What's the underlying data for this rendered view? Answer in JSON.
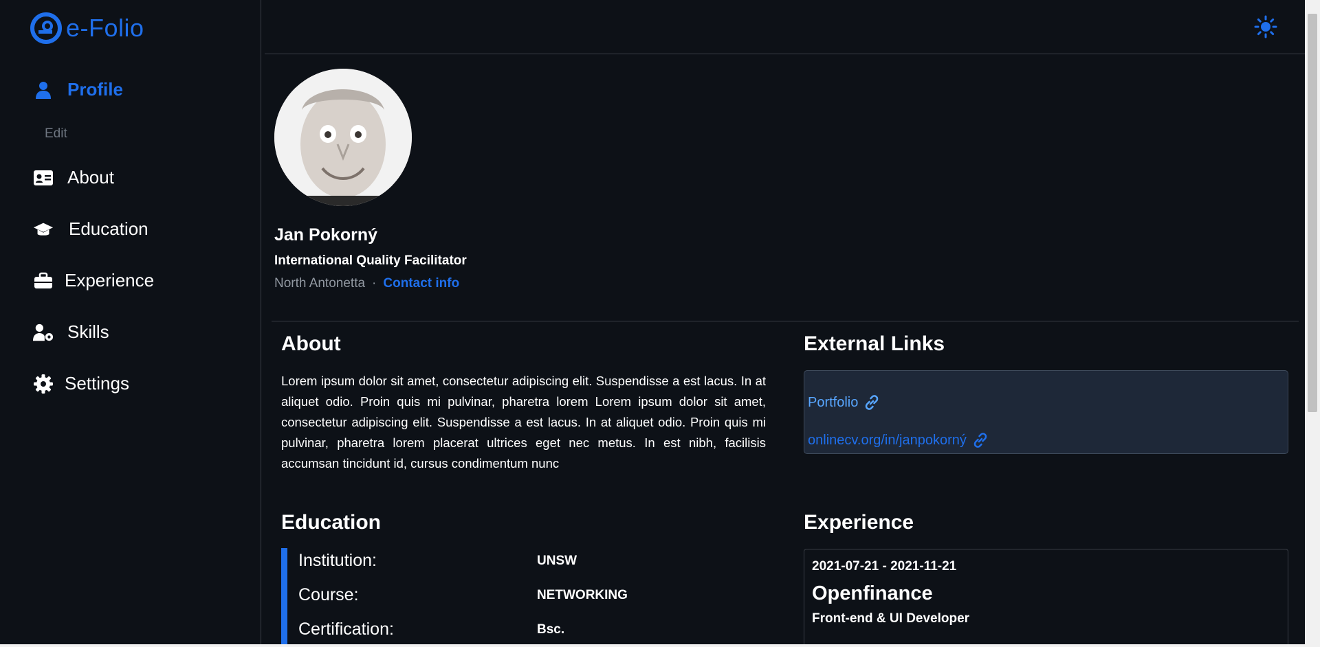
{
  "app": {
    "logo_text": "e-Folio"
  },
  "colors": {
    "accent": "#1f6feb",
    "background": "#0d1117",
    "link_box": "#1e2838"
  },
  "sidebar": {
    "items": [
      {
        "label": "Profile",
        "icon": "user-icon",
        "active": true
      },
      {
        "label": "About",
        "icon": "id-card-icon"
      },
      {
        "label": "Education",
        "icon": "graduation-cap-icon"
      },
      {
        "label": "Experience",
        "icon": "briefcase-icon"
      },
      {
        "label": "Skills",
        "icon": "user-gear-icon"
      },
      {
        "label": "Settings",
        "icon": "gear-icon"
      }
    ],
    "sub_edit": "Edit"
  },
  "topbar": {
    "theme_icon": "sun-icon"
  },
  "profile": {
    "name": "Jan Pokorný",
    "title": "International Quality Facilitator",
    "location": "North Antonetta",
    "separator": "·",
    "contact_label": "Contact info"
  },
  "about": {
    "heading": "About",
    "text": "Lorem ipsum dolor sit amet, consectetur adipiscing elit. Suspendisse a est lacus. In at aliquet odio. Proin quis mi pulvinar, pharetra lorem Lorem ipsum dolor sit amet, consectetur adipiscing elit. Suspendisse a est lacus. In at aliquet odio. Proin quis mi pulvinar, pharetra lorem placerat ultrices eget nec metus. In est nibh, facilisis accumsan tincidunt id, cursus condimentum nunc"
  },
  "links": {
    "heading": "External Links",
    "items": [
      {
        "label": "Portfolio"
      },
      {
        "label": "onlinecv.org/in/janpokorný"
      }
    ]
  },
  "education": {
    "heading": "Education",
    "rows": [
      {
        "label": "Institution:",
        "value": "UNSW"
      },
      {
        "label": "Course:",
        "value": "NETWORKING"
      },
      {
        "label": "Certification:",
        "value": "Bsc."
      }
    ]
  },
  "experience": {
    "heading": "Experience",
    "items": [
      {
        "dates": "2021-07-21 - 2021-11-21",
        "company": "Openfinance",
        "role": "Front-end & UI Developer"
      }
    ]
  }
}
